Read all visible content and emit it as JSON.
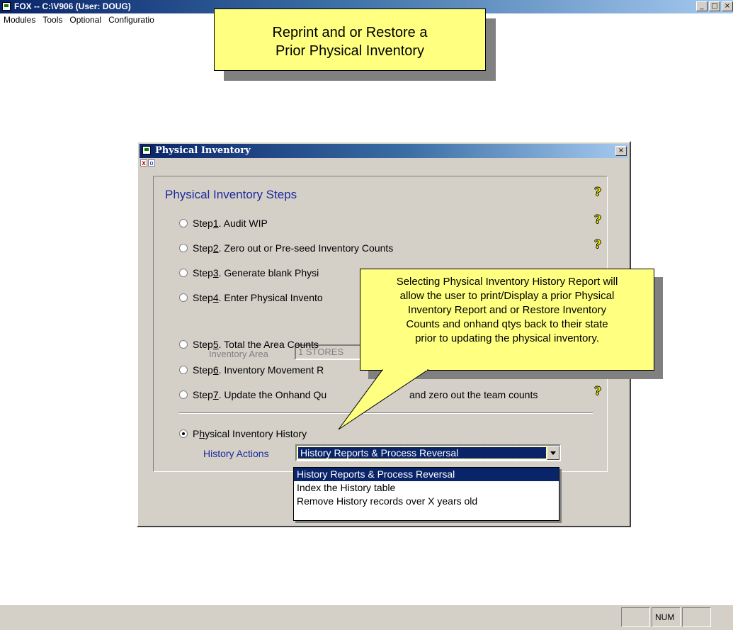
{
  "app": {
    "title": "FOX -- C:\\V906  (User: DOUG)",
    "min_glyph": "_",
    "max_glyph": "□",
    "close_glyph": "×"
  },
  "menu": [
    "Modules",
    "Tools",
    "Optional",
    "Configuratio"
  ],
  "title_callout": {
    "line1": "Reprint and or Restore a",
    "line2": "Prior Physical Inventory"
  },
  "dialog": {
    "title": "Physical Inventory",
    "close_glyph": "×",
    "mini_x": "x",
    "mini_o": "o",
    "group_title": "Physical Inventory Steps",
    "help_glyph": "?",
    "steps": [
      {
        "prefix": "Step ",
        "num": "1",
        "text": ".  Audit WIP"
      },
      {
        "prefix": "Step ",
        "num": "2",
        "text": ".  Zero out or Pre-seed Inventory Counts"
      },
      {
        "prefix": "Step ",
        "num": "3",
        "text": ".  Generate blank Physi"
      },
      {
        "prefix": "Step ",
        "num": "4",
        "text": ".  Enter Physical Invento"
      },
      {
        "prefix": "Step ",
        "num": "5",
        "text": ".  Total the Area Counts"
      },
      {
        "prefix": "Step ",
        "num": "6",
        "text": ".  Inventory Movement R"
      },
      {
        "prefix": "Step ",
        "num": "7",
        "text": ".  Update the Onhand Qu"
      },
      {
        "extra": "and zero out the team counts"
      }
    ],
    "area_label": "Inventory Area",
    "area_value": "1  STORES",
    "history_prefix": "P",
    "history_underline": "h",
    "history_rest": "ysical Inventory History",
    "actions_label": "History Actions",
    "actions_value": "History Reports & Process Reversal",
    "dropdown_options": [
      "History Reports & Process Reversal",
      "Index the History table",
      "Remove History records over X years old"
    ]
  },
  "tooltip": {
    "line1": "Selecting Physical Inventory History Report will",
    "line2": "allow the user to print/Display a prior Physical",
    "line3": "Inventory Report and or Restore Inventory",
    "line4": "Counts and onhand qtys back to their state",
    "line5": "prior to updating the physical inventory."
  },
  "statusbar": {
    "num": "NUM"
  },
  "colors": {
    "callout": "#ffff80",
    "titlebar": "#0a246a",
    "label_blue": "#1c2a9c"
  }
}
